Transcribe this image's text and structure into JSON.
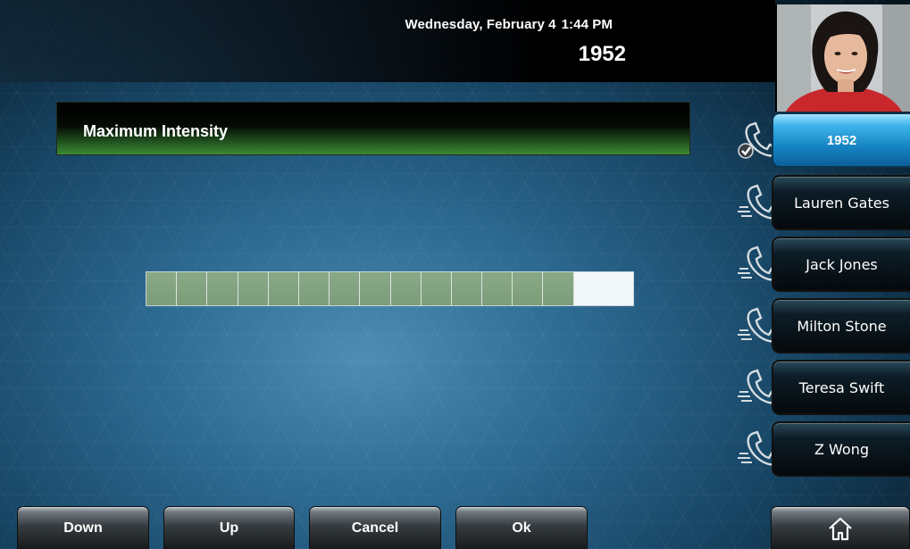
{
  "status": {
    "date": "Wednesday, February 4",
    "time": "1:44 PM",
    "line_number": "1952"
  },
  "screen": {
    "title": "Maximum Intensity",
    "intensity": {
      "level": 14,
      "max": 16
    }
  },
  "lines": [
    {
      "label": "1952",
      "active": true,
      "icon": "phone-checkmark-icon"
    },
    {
      "label": "Lauren Gates",
      "active": false,
      "icon": "phone-handset-icon"
    },
    {
      "label": "Jack Jones",
      "active": false,
      "icon": "phone-handset-icon"
    },
    {
      "label": "Milton Stone",
      "active": false,
      "icon": "phone-handset-icon"
    },
    {
      "label": "Teresa Swift",
      "active": false,
      "icon": "phone-handset-icon"
    },
    {
      "label": "Z Wong",
      "active": false,
      "icon": "phone-handset-icon"
    }
  ],
  "softkeys": {
    "down": "Down",
    "up": "Up",
    "cancel": "Cancel",
    "ok": "Ok"
  },
  "home_icon": "home-icon",
  "colors": {
    "accent_blue": "#1684c3",
    "title_green": "#3d8a35",
    "meter_fill": "#7c9d7a",
    "meter_empty": "#f2f7f9"
  }
}
